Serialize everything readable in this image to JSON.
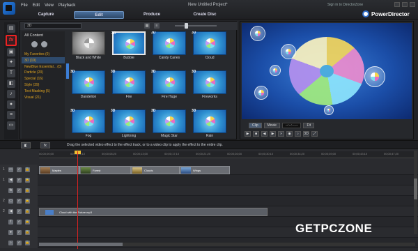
{
  "menu": [
    "File",
    "Edit",
    "View",
    "Playback"
  ],
  "project_title": "New Untitled Project*",
  "directorzone_link": "Sign in to DirectorZone",
  "brand": "PowerDirector",
  "tabs": [
    "Capture",
    "Edit",
    "Produce",
    "Create Disc"
  ],
  "library": {
    "dropdown_value": "3D",
    "all_content": "All Content",
    "categories": [
      {
        "label": "My Favorites (0)"
      },
      {
        "label": "3D (19)"
      },
      {
        "label": "NewBlue Essential... (0)"
      },
      {
        "label": "Particle (20)"
      },
      {
        "label": "Special (16)"
      },
      {
        "label": "Style (39)"
      },
      {
        "label": "Text Masking (5)"
      },
      {
        "label": "Visual (21)"
      }
    ],
    "effects": [
      {
        "label": "Black and White",
        "tag": ""
      },
      {
        "label": "Bubble",
        "tag": "3D"
      },
      {
        "label": "Candy Canes",
        "tag": "3D"
      },
      {
        "label": "Cloud",
        "tag": "3D"
      },
      {
        "label": "Dandelion",
        "tag": "3D"
      },
      {
        "label": "Fire",
        "tag": "3D"
      },
      {
        "label": "Fire Huge",
        "tag": "3D"
      },
      {
        "label": "Fireworks",
        "tag": "3D"
      },
      {
        "label": "Fog",
        "tag": "3D"
      },
      {
        "label": "Lightning",
        "tag": "3D"
      },
      {
        "label": "Magic Star",
        "tag": "3D"
      },
      {
        "label": "Rain",
        "tag": "3D"
      }
    ]
  },
  "preview": {
    "clip_btn": "Clip",
    "movie_btn": "Movie",
    "timecode": "--:--:--.--",
    "fx_btn": "Fit"
  },
  "instruction": "Drag the selected video effect to the effect track, or to a video clip to apply the effect to the entire clip.",
  "ruler_marks": [
    "00;00;00;00",
    "00;00;04;10",
    "00;00;08;20",
    "00;00;13;00",
    "00;00;17;10",
    "00;00;21;20",
    "00;00;26;00",
    "00;00;30;10",
    "00;00;34;20",
    "00;00;39;00",
    "00;00;43;10",
    "00;00;47;20"
  ],
  "clips": [
    "Maples",
    "Forest",
    "Clouds",
    "Wings"
  ],
  "audio_clip": "Cloud with the Future.mp3",
  "track_numbers": [
    "1",
    "1",
    "",
    "2",
    "2",
    "",
    "",
    ""
  ],
  "watermark": "GETPCZONE"
}
